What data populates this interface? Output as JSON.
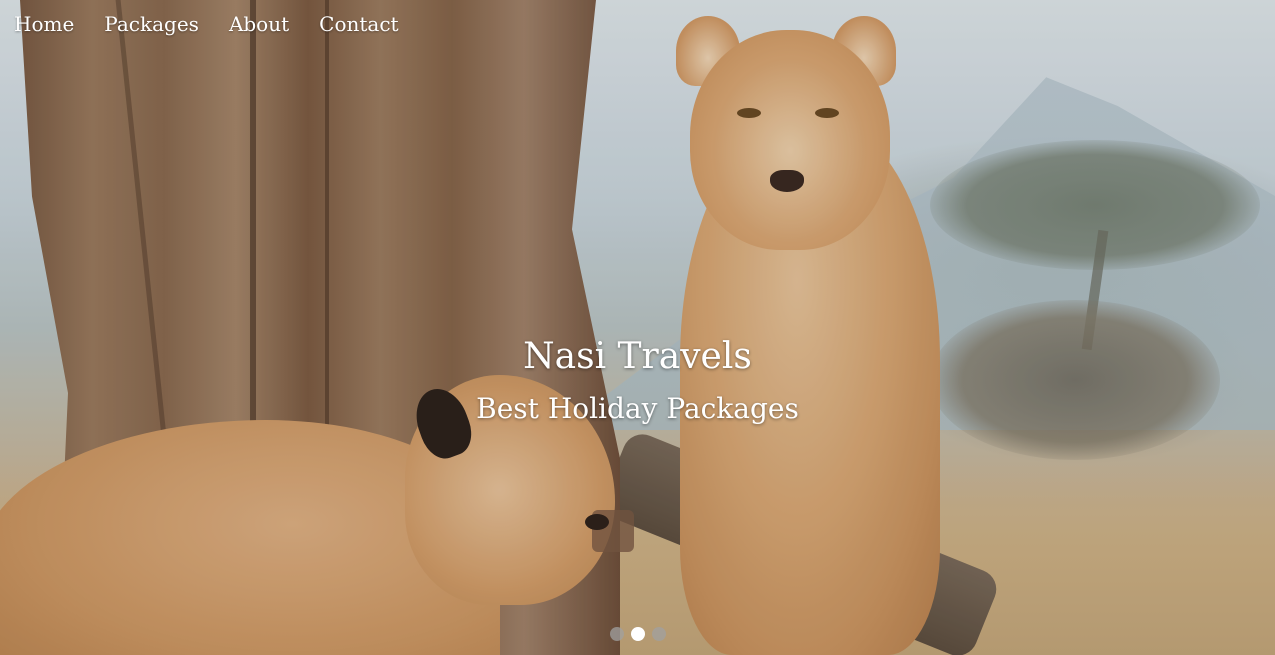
{
  "nav": {
    "items": [
      {
        "label": "Home"
      },
      {
        "label": "Packages"
      },
      {
        "label": "About"
      },
      {
        "label": "Contact"
      }
    ]
  },
  "hero": {
    "title": "Nasi Travels",
    "subtitle": "Best Holiday Packages",
    "background_image": "two-lionesses-savanna-photo"
  },
  "carousel": {
    "slide_count": 3,
    "active_index": 1
  },
  "colors": {
    "text": "#ffffff",
    "dot_inactive": "#a0a0a0",
    "dot_active": "#ffffff"
  }
}
